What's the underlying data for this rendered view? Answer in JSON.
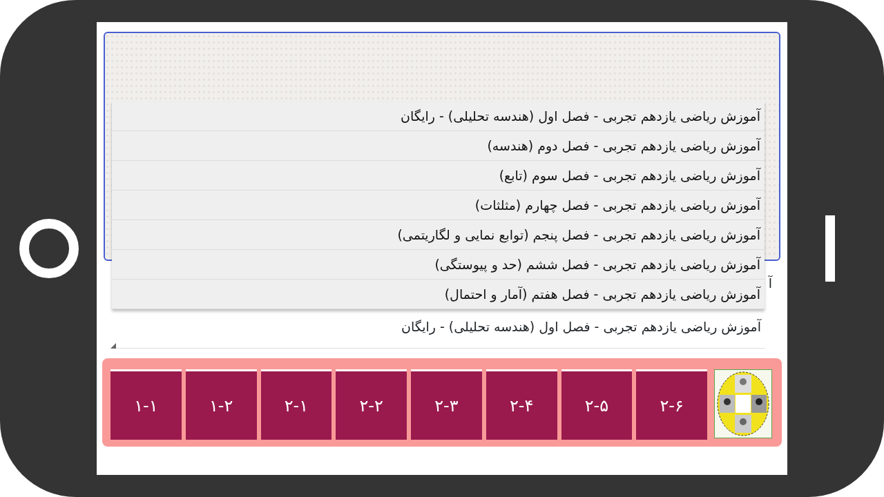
{
  "dropdown": {
    "options": [
      {
        "label": "آموزش ریاضی یازدهم تجربی - فصل اول (هندسه تحلیلی) - رایگان"
      },
      {
        "label": "آموزش ریاضی یازدهم تجربی - فصل دوم (هندسه)"
      },
      {
        "label": "آموزش ریاضی یازدهم تجربی - فصل سوم (تابع)"
      },
      {
        "label": "آموزش ریاضی یازدهم تجربی - فصل چهارم (مثلثات)"
      },
      {
        "label": "آموزش ریاضی یازدهم تجربی - فصل پنجم (توابع نمایی و لگاریتمی)"
      },
      {
        "label": "آموزش ریاضی یازدهم تجربی - فصل ششم (حد و پیوستگی)"
      },
      {
        "label": "آموزش ریاضی یازدهم تجربی - فصل هفتم (آمار و احتمال)"
      }
    ]
  },
  "field_label": "آ",
  "select": {
    "value": "آموزش ریاضی یازدهم تجربی - فصل اول (هندسه تحلیلی) - رایگان"
  },
  "lesson_buttons": [
    "۲-۶",
    "۲-۵",
    "۲-۴",
    "۲-۳",
    "۲-۲",
    "۲-۱",
    "۱-۲",
    "۱-۱"
  ]
}
